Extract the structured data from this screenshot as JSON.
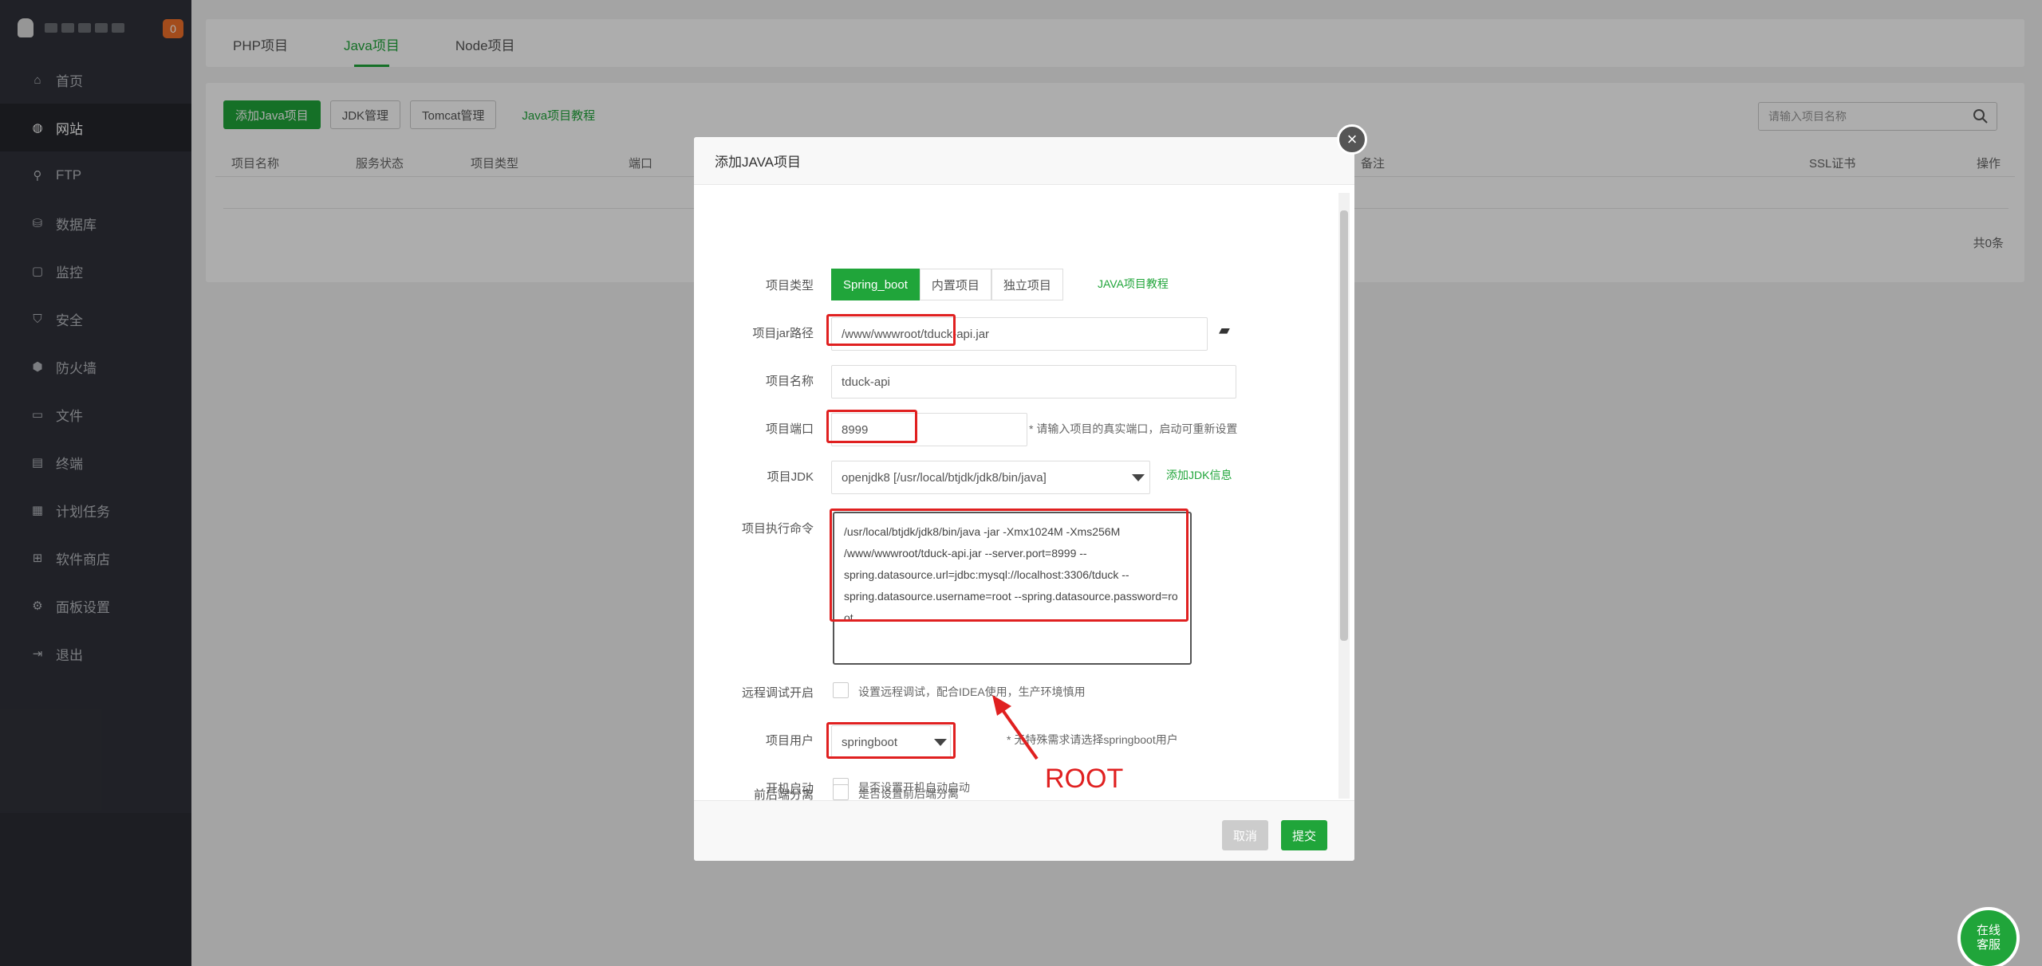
{
  "sidebar": {
    "badge": "0",
    "items": [
      {
        "label": "首页",
        "icon": "home-icon"
      },
      {
        "label": "网站",
        "icon": "globe-icon",
        "active": true
      },
      {
        "label": "FTP",
        "icon": "ftp-icon"
      },
      {
        "label": "数据库",
        "icon": "database-icon"
      },
      {
        "label": "监控",
        "icon": "monitor-icon"
      },
      {
        "label": "安全",
        "icon": "shield-icon"
      },
      {
        "label": "防火墙",
        "icon": "firewall-icon"
      },
      {
        "label": "文件",
        "icon": "folder-icon"
      },
      {
        "label": "终端",
        "icon": "terminal-icon"
      },
      {
        "label": "计划任务",
        "icon": "calendar-icon"
      },
      {
        "label": "软件商店",
        "icon": "apps-icon"
      },
      {
        "label": "面板设置",
        "icon": "settings-icon"
      },
      {
        "label": "退出",
        "icon": "logout-icon"
      }
    ]
  },
  "tabs": [
    "PHP项目",
    "Java项目",
    "Node项目"
  ],
  "toolbar": {
    "add_java": "添加Java项目",
    "jdk": "JDK管理",
    "tomcat": "Tomcat管理",
    "tutorial": "Java项目教程"
  },
  "search": {
    "placeholder": "请输入项目名称"
  },
  "table": {
    "headers": [
      "项目名称",
      "服务状态",
      "项目类型",
      "端口",
      "备注",
      "SSL证书",
      "操作"
    ],
    "total": "共0条"
  },
  "modal": {
    "title": "添加JAVA项目",
    "project_type": {
      "label": "项目类型",
      "options": [
        "Spring_boot",
        "内置项目",
        "独立项目"
      ],
      "link": "JAVA项目教程"
    },
    "jar_path": {
      "label": "项目jar路径",
      "value": "/www/wwwroot/tduck-api.jar"
    },
    "name": {
      "label": "项目名称",
      "value": "tduck-api"
    },
    "port": {
      "label": "项目端口",
      "value": "8999",
      "hint": "* 请输入项目的真实端口，启动可重新设置"
    },
    "jdk": {
      "label": "项目JDK",
      "value": "openjdk8 [/usr/local/btjdk/jdk8/bin/java]",
      "link": "添加JDK信息"
    },
    "command": {
      "label": "项目执行命令",
      "lines": [
        "/usr/local/btjdk/jdk8/bin/java -jar -Xmx1024M -Xms256M",
        "/www/wwwroot/tduck-api.jar --server.port=8999  --",
        "spring.datasource.url=jdbc:mysql://localhost:3306/tduck --",
        "spring.datasource.username=root --spring.datasource.password=root"
      ]
    },
    "debug": {
      "label": "远程调试开启",
      "text": "设置远程调试，配合IDEA使用，生产环境慎用"
    },
    "user": {
      "label": "项目用户",
      "value": "springboot",
      "hint": "* 无特殊需求请选择springboot用户"
    },
    "autostart": {
      "label": "开机启动",
      "text": "是否设置开机自动启动"
    },
    "split": {
      "label": "前后端分离",
      "text": "是否设置前后端分离"
    },
    "cancel": "取消",
    "submit": "提交"
  },
  "annotation": {
    "text": "ROOT",
    "color": "#e02020"
  },
  "chat": {
    "line1": "在线",
    "line2": "客服"
  },
  "colors": {
    "accent": "#20a53a",
    "sidebar": "#30323a",
    "highlight": "#e02020"
  }
}
